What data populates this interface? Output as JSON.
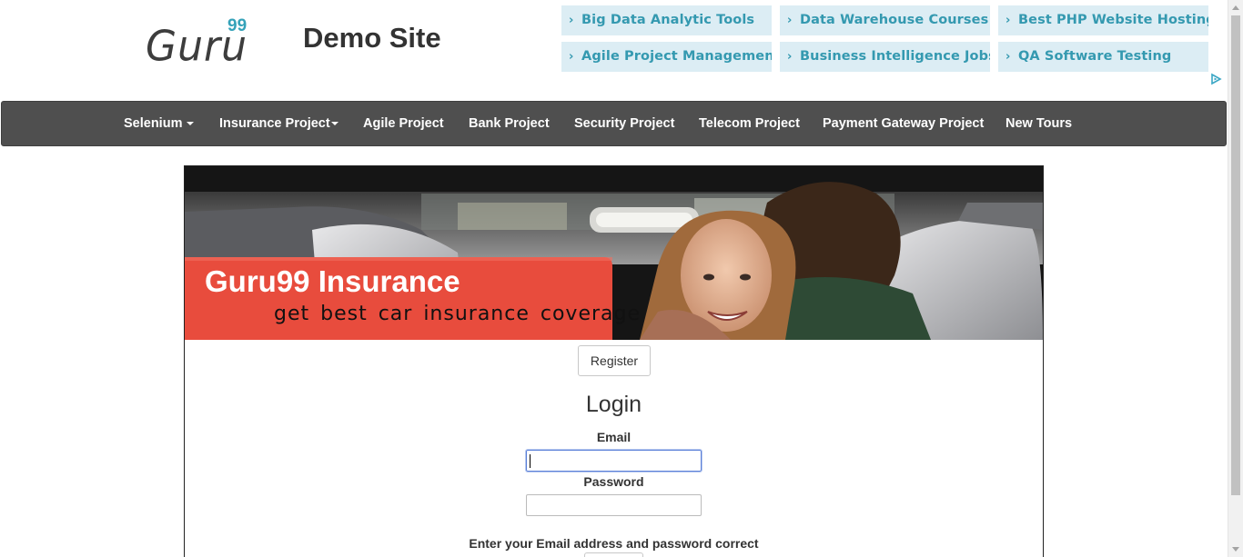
{
  "header": {
    "logo_word": "Guru",
    "logo_number": "99",
    "site_title": "Demo Site"
  },
  "ads": [
    {
      "label": "Big Data Analytic Tools"
    },
    {
      "label": "Data Warehouse Courses"
    },
    {
      "label": "Best PHP Website Hosting"
    },
    {
      "label": "Agile Project Management"
    },
    {
      "label": "Business Intelligence Jobs"
    },
    {
      "label": "QA Software Testing"
    }
  ],
  "ad_chevron": "›",
  "nav": {
    "items": [
      {
        "label": "Selenium",
        "dropdown": true
      },
      {
        "label": "Insurance Project",
        "dropdown": true
      },
      {
        "label": "Agile Project",
        "dropdown": false
      },
      {
        "label": "Bank Project",
        "dropdown": false
      },
      {
        "label": "Security Project",
        "dropdown": false
      },
      {
        "label": "Telecom Project",
        "dropdown": false
      },
      {
        "label": "Payment Gateway Project",
        "dropdown": false
      },
      {
        "label": "New Tours",
        "dropdown": false
      }
    ]
  },
  "banner": {
    "title": "Guru99 Insurance",
    "subtitle": "get best car insurance coverage"
  },
  "login": {
    "register_label": "Register",
    "heading": "Login",
    "email_label": "Email",
    "email_value": "",
    "password_label": "Password",
    "password_value": "",
    "hint": "Enter your Email address and password correct"
  },
  "colors": {
    "accent": "#35a2b9",
    "ad_bg": "#dcedf4",
    "nav_bg": "#4f4f4f",
    "banner_red": "#e84c3d"
  },
  "icons": {
    "ad_choices": "adchoices-triangle-icon"
  }
}
